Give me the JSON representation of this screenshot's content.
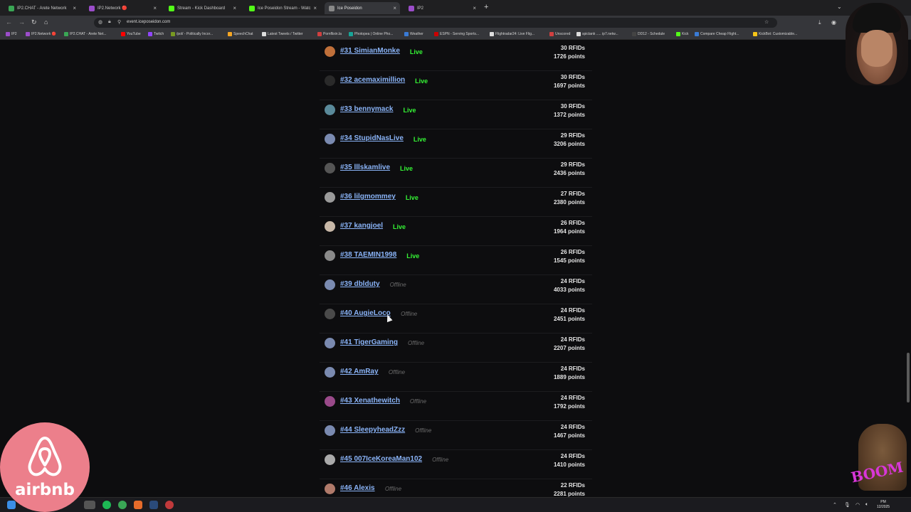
{
  "browser": {
    "tabs": [
      {
        "label": "IP2.CHAT - Arete Network",
        "color": "#3aa655"
      },
      {
        "label": "IP2.Network 🔴",
        "color": "#9b4dca"
      },
      {
        "label": "Stream - Kick Dashboard",
        "color": "#53fc18"
      },
      {
        "label": "Ice Poseidon Stream - Watc",
        "color": "#53fc18"
      },
      {
        "label": "Ice Poseidon",
        "color": "#888888"
      },
      {
        "label": "IP2",
        "color": "#9b4dca"
      }
    ],
    "active_tab_index": 4,
    "url": "event.iceposeidon.com",
    "new_tab_label": "+",
    "close_label": "×"
  },
  "bookmarks": [
    {
      "label": "IP2",
      "color": "#9b4dca"
    },
    {
      "label": "IP2.Network 🔴",
      "color": "#9b4dca"
    },
    {
      "label": "IP2.CHAT - Arete Net...",
      "color": "#3aa655"
    },
    {
      "label": "YouTube",
      "color": "#ff0000"
    },
    {
      "label": "Twitch",
      "color": "#9146ff"
    },
    {
      "label": "/pol/ - Politically Incor...",
      "color": "#789922"
    },
    {
      "label": "SpeechChat",
      "color": "#f5a623"
    },
    {
      "label": "Latest Tweets / Twitter",
      "color": "#dddddd"
    },
    {
      "label": "Pornflixin.la",
      "color": "#d04040"
    },
    {
      "label": "Photopea | Online Pho...",
      "color": "#18a497"
    },
    {
      "label": "Weather",
      "color": "#3a7bd5"
    },
    {
      "label": "ESPN - Serving Sports...",
      "color": "#cc0000"
    },
    {
      "label": "Flightradar24: Live Flig...",
      "color": "#dddddd"
    },
    {
      "label": "Unscored",
      "color": "#d04040"
    },
    {
      "label": "spictank ..... ip7.netw...",
      "color": "#dddddd"
    },
    {
      "label": "DD12 - Schedule",
      "color": "#444444"
    },
    {
      "label": "Kick",
      "color": "#53fc18"
    },
    {
      "label": "Compare Cheap Flight...",
      "color": "#3a7bd5"
    },
    {
      "label": "KickBot: Customizable...",
      "color": "#f5c518"
    }
  ],
  "leaderboard": [
    {
      "rank_name": "#31 SimianMonke",
      "status": "Live",
      "rfids": "30 RFIDs",
      "points": "1726 points",
      "avatar_color": "#c0703a"
    },
    {
      "rank_name": "#32 acemaximillion",
      "status": "Live",
      "rfids": "30 RFIDs",
      "points": "1697 points",
      "avatar_color": "#2a2a2a"
    },
    {
      "rank_name": "#33 bennymack",
      "status": "Live",
      "rfids": "30 RFIDs",
      "points": "1372 points",
      "avatar_color": "#5a8a9a"
    },
    {
      "rank_name": "#34 StupidNasLive",
      "status": "Live",
      "rfids": "29 RFIDs",
      "points": "3206 points",
      "avatar_color": "#7a8ab0"
    },
    {
      "rank_name": "#35 lllskamlive",
      "status": "Live",
      "rfids": "29 RFIDs",
      "points": "2436 points",
      "avatar_color": "#555555"
    },
    {
      "rank_name": "#36 lilgmommey",
      "status": "Live",
      "rfids": "27 RFIDs",
      "points": "2380 points",
      "avatar_color": "#9a9a9a"
    },
    {
      "rank_name": "#37 kangjoel",
      "status": "Live",
      "rfids": "26 RFIDs",
      "points": "1964 points",
      "avatar_color": "#c8b8a8"
    },
    {
      "rank_name": "#38 TAEMIN1998",
      "status": "Live",
      "rfids": "26 RFIDs",
      "points": "1545 points",
      "avatar_color": "#8a8a8a"
    },
    {
      "rank_name": "#39 dblduty",
      "status": "Offline",
      "rfids": "24 RFIDs",
      "points": "4033 points",
      "avatar_color": "#7a8ab0"
    },
    {
      "rank_name": "#40 AugieLoco",
      "status": "Offline",
      "rfids": "24 RFIDs",
      "points": "2451 points",
      "avatar_color": "#4a4a4a"
    },
    {
      "rank_name": "#41 TigerGaming",
      "status": "Offline",
      "rfids": "24 RFIDs",
      "points": "2207 points",
      "avatar_color": "#7a8ab0"
    },
    {
      "rank_name": "#42 AmRay",
      "status": "Offline",
      "rfids": "24 RFIDs",
      "points": "1889 points",
      "avatar_color": "#7a8ab0"
    },
    {
      "rank_name": "#43 Xenathewitch",
      "status": "Offline",
      "rfids": "24 RFIDs",
      "points": "1792 points",
      "avatar_color": "#9a4a8a"
    },
    {
      "rank_name": "#44 SleepyheadZzz",
      "status": "Offline",
      "rfids": "24 RFIDs",
      "points": "1467 points",
      "avatar_color": "#7a8ab0"
    },
    {
      "rank_name": "#45 007IceKoreaMan102",
      "status": "Offline",
      "rfids": "24 RFIDs",
      "points": "1410 points",
      "avatar_color": "#aaaaaa"
    },
    {
      "rank_name": "#46 Alexis",
      "status": "Offline",
      "rfids": "22 RFIDs",
      "points": "2281 points",
      "avatar_color": "#b07a6a"
    }
  ],
  "overlay": {
    "airbnb_word": "airbnb",
    "sticker_text": "BOOM"
  },
  "taskbar": {
    "clock_time": "PM",
    "clock_date": "12/2025"
  }
}
